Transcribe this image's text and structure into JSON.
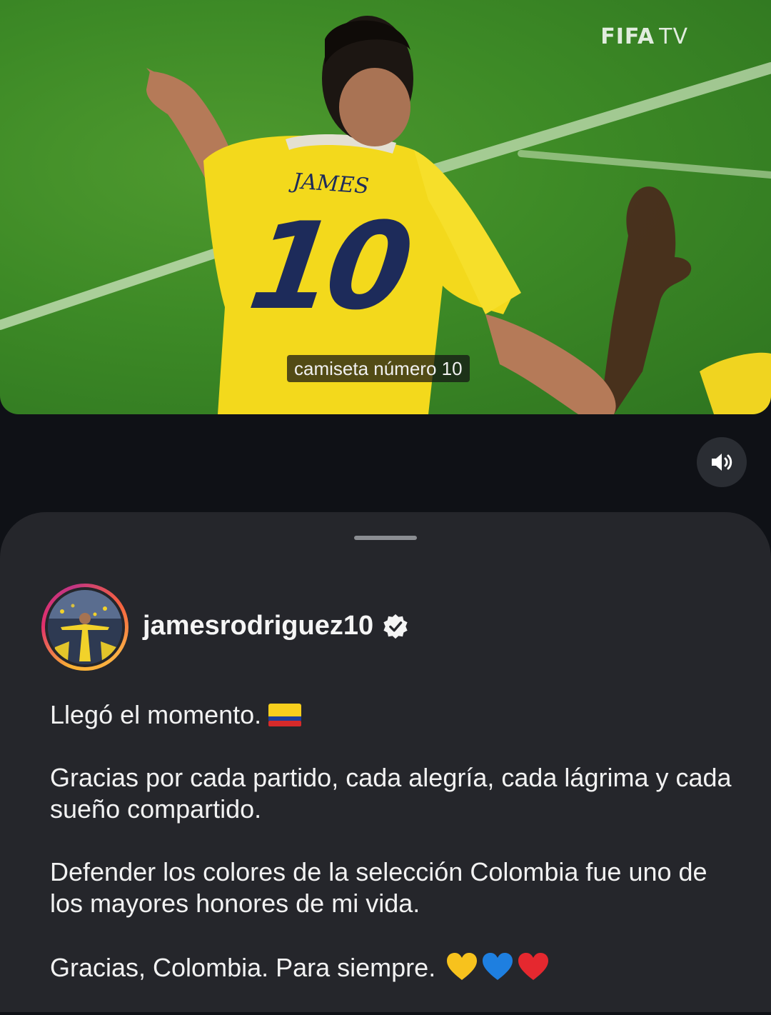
{
  "video": {
    "watermark_bold": "FIFA",
    "watermark_light": "TV",
    "jersey_name": "JAMES",
    "jersey_number": "10",
    "subtitle": "camiseta número 10"
  },
  "controls": {
    "mute_icon": "volume-icon"
  },
  "post": {
    "username": "jamesrodriguez10",
    "verified": true,
    "caption": {
      "line1": "Llegó el momento.",
      "para2": "Gracias por cada partido, cada alegría, cada lágrima y cada sueño compartido.",
      "para3": "Defender los colores de la selección Colombia fue uno de los mayores honores de mi vida.",
      "para4": "Gracias, Colombia. Para siempre."
    },
    "emojis": [
      "colombia-flag",
      "yellow-heart",
      "blue-heart",
      "red-heart"
    ]
  },
  "colors": {
    "background": "#0f1116",
    "sheet": "#25262b",
    "pitch": "#3d8a26",
    "jersey": "#f3d91c",
    "jersey_number": "#1d2b5a"
  }
}
